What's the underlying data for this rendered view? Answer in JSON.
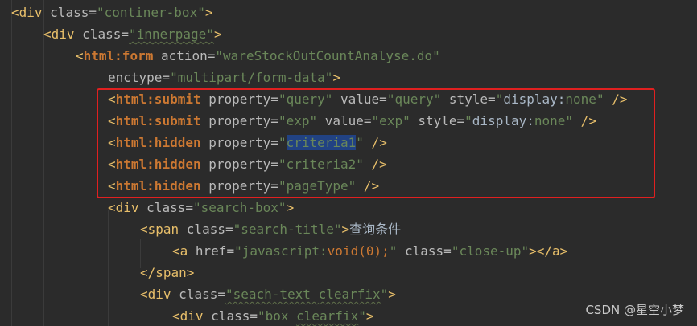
{
  "lines": [
    [
      "<div ",
      "class=",
      "\"continer-box\"",
      ">"
    ],
    [
      "<div ",
      "class=",
      "\"innerpage\"",
      ">"
    ],
    [
      "<",
      "html:form ",
      "action=",
      "\"wareStockOutCountAnalyse.do\""
    ],
    [
      "enctype=",
      "\"multipart/form-data\"",
      ">"
    ],
    [
      "<",
      "html:submit ",
      "property=",
      "\"query\"",
      " value=",
      "\"query\"",
      " style=",
      "\"",
      "display",
      ":",
      "none",
      "\"",
      " />"
    ],
    [
      "<",
      "html:submit ",
      "property=",
      "\"exp\"",
      " value=",
      "\"exp\"",
      " style=",
      "\"",
      "display",
      ":",
      "none",
      "\"",
      " />"
    ],
    [
      "<",
      "html:hidden ",
      "property=",
      "\"",
      "criteria1",
      "\"",
      " />"
    ],
    [
      "<",
      "html:hidden ",
      "property=",
      "\"criteria2\"",
      " />"
    ],
    [
      "<",
      "html:hidden ",
      "property=",
      "\"pageType\"",
      " />"
    ],
    [
      "<div ",
      "class=",
      "\"search-box\"",
      ">"
    ],
    [
      "<span ",
      "class=",
      "\"search-title\"",
      ">",
      "查询条件"
    ],
    [
      "<a ",
      "href=",
      "\"javascript:",
      "void",
      "(0);",
      "\"",
      " class=",
      "\"close-up\"",
      "></a>"
    ],
    [
      "</span>"
    ],
    [
      "<div ",
      "class=",
      "\"seach-text ",
      "clearfix",
      "\"",
      ">"
    ],
    [
      "<div ",
      "class=",
      "\"box ",
      "clearfix",
      "\"",
      ">"
    ]
  ],
  "watermark": "CSDN @星空小梦"
}
